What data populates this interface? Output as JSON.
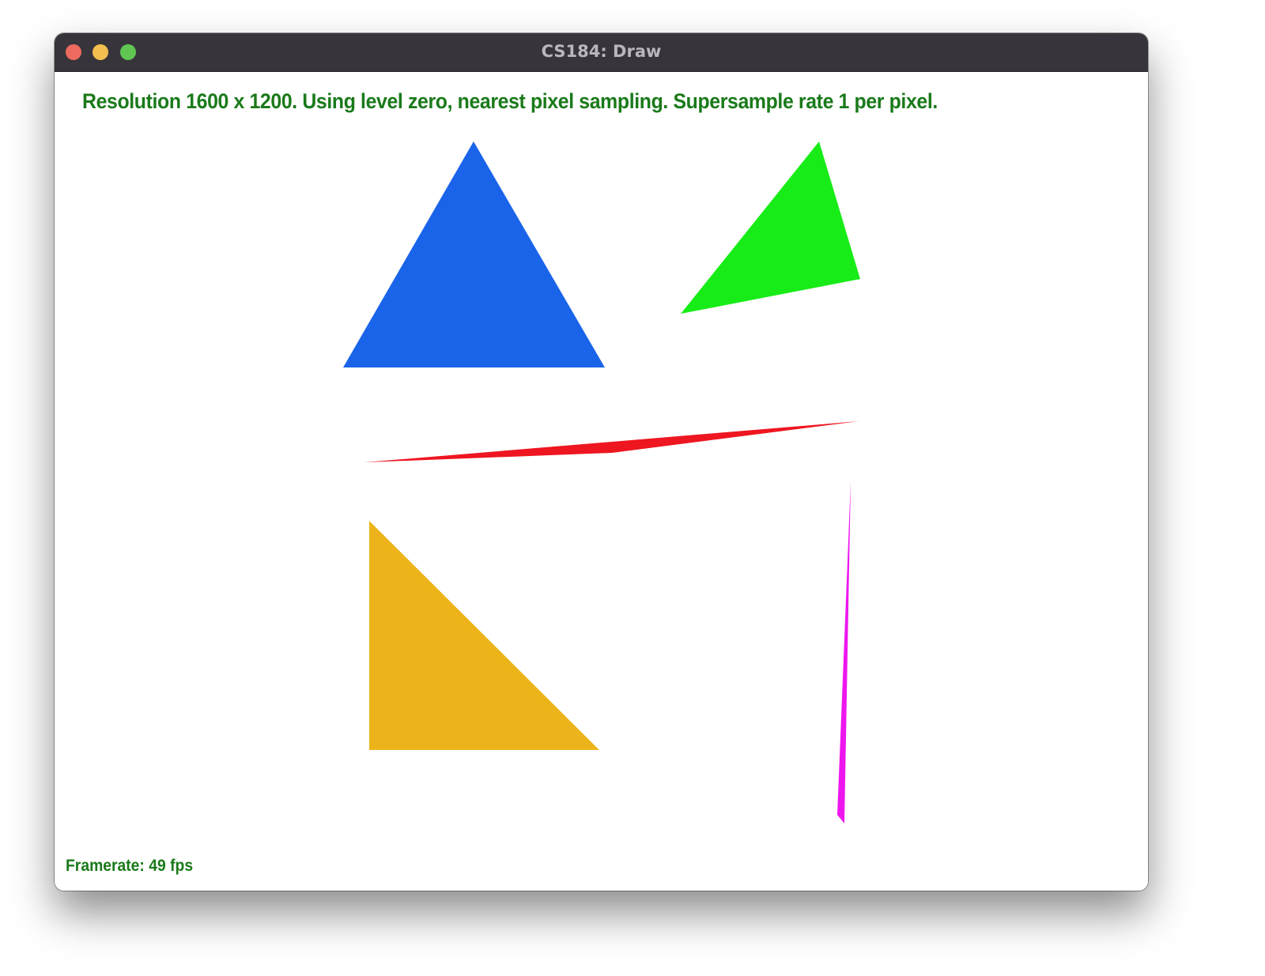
{
  "window": {
    "title": "CS184: Draw",
    "buttons": [
      {
        "name": "close",
        "color": "#ed6a5e"
      },
      {
        "name": "minimize",
        "color": "#f4bf4f"
      },
      {
        "name": "maximize",
        "color": "#61c554"
      }
    ]
  },
  "overlay": {
    "status_text": "Resolution 1600 x 1200. Using level zero, nearest pixel sampling. Supersample rate 1 per pixel.",
    "framerate_text": "Framerate: 49 fps",
    "text_color": "#1a7a1a"
  },
  "scene": {
    "shapes": [
      {
        "name": "blue-triangle",
        "color": "#1a64ea"
      },
      {
        "name": "green-triangle",
        "color": "#18ec18"
      },
      {
        "name": "red-sliver-triangle",
        "color": "#ee1620"
      },
      {
        "name": "yellow-triangle",
        "color": "#ecb41a"
      },
      {
        "name": "magenta-sliver-triangle",
        "color": "#ee16ee"
      }
    ]
  }
}
